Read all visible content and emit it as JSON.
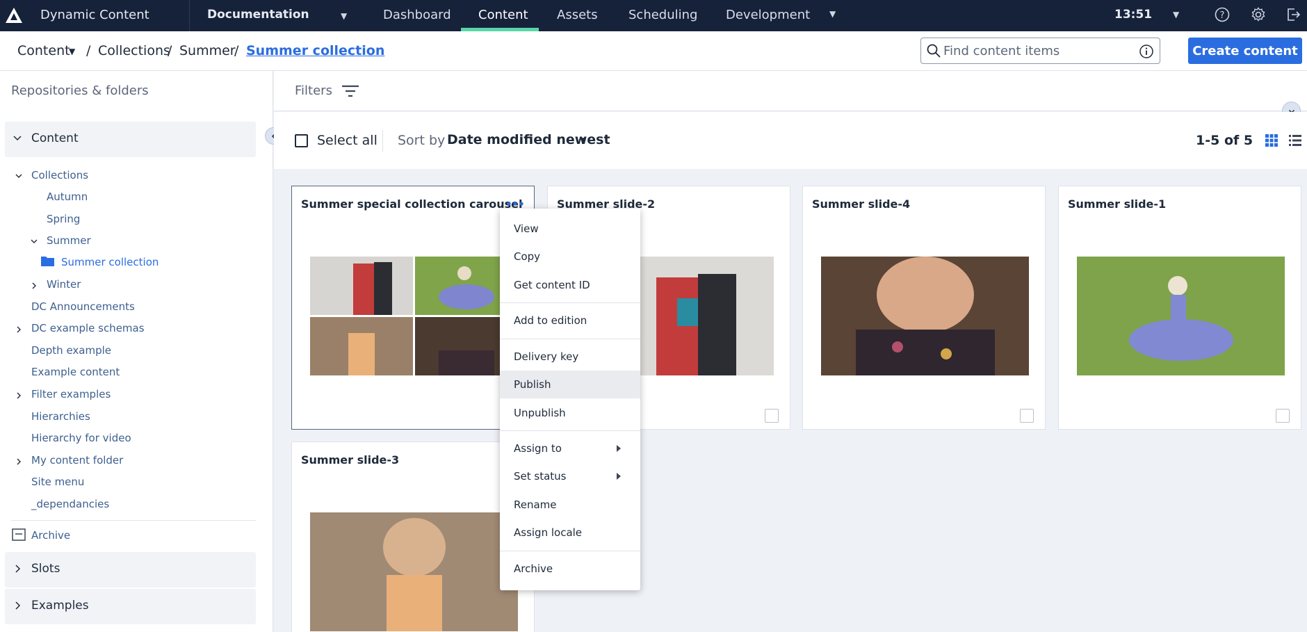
{
  "topnav": {
    "app_name": "Dynamic Content",
    "hub": "Documentation",
    "tabs": [
      "Dashboard",
      "Content",
      "Assets",
      "Scheduling",
      "Development"
    ],
    "active_tab": "Content",
    "time": "13:51",
    "icons": [
      "amplience-logo-icon",
      "help-icon",
      "settings-gear-icon",
      "logout-icon"
    ],
    "nav_bg": "#16213a",
    "accent": "#58d6a8"
  },
  "breadcrumb": {
    "items": [
      "Content",
      "Collections",
      "Summer",
      "Summer collection"
    ],
    "separator": "/"
  },
  "search": {
    "placeholder": "Find content items"
  },
  "create_button": "Create content",
  "sidebar": {
    "title": "Repositories & folders",
    "sections": [
      "Content",
      "Slots",
      "Examples"
    ],
    "tree": [
      "Collections",
      "Autumn",
      "Spring",
      "Summer",
      "Summer collection",
      "Winter",
      "DC Announcements",
      "DC example schemas",
      "Depth example",
      "Example content",
      "Filter examples",
      "Hierarchies",
      "Hierarchy for video",
      "My content folder",
      "Site menu",
      "_dependancies",
      "Archive"
    ]
  },
  "filters": {
    "label": "Filters"
  },
  "toolbar": {
    "select_all": "Select all",
    "sort_by": "Sort by",
    "sort_value": "Date modified newest",
    "count": "1-5 of 5"
  },
  "cards": [
    {
      "title": "Summer special collection carousel"
    },
    {
      "title": "Summer slide-2"
    },
    {
      "title": "Summer slide-4"
    },
    {
      "title": "Summer slide-1"
    },
    {
      "title": "Summer slide-3"
    }
  ],
  "context_menu": {
    "items": [
      "View",
      "Copy",
      "Get content ID",
      "Add to edition",
      "Delivery key",
      "Publish",
      "Unpublish",
      "Assign to",
      "Set status",
      "Rename",
      "Assign locale",
      "Archive"
    ],
    "highlighted": "Publish"
  },
  "colors": {
    "primary": "#2a6de0",
    "link": "#3d5f8f"
  }
}
